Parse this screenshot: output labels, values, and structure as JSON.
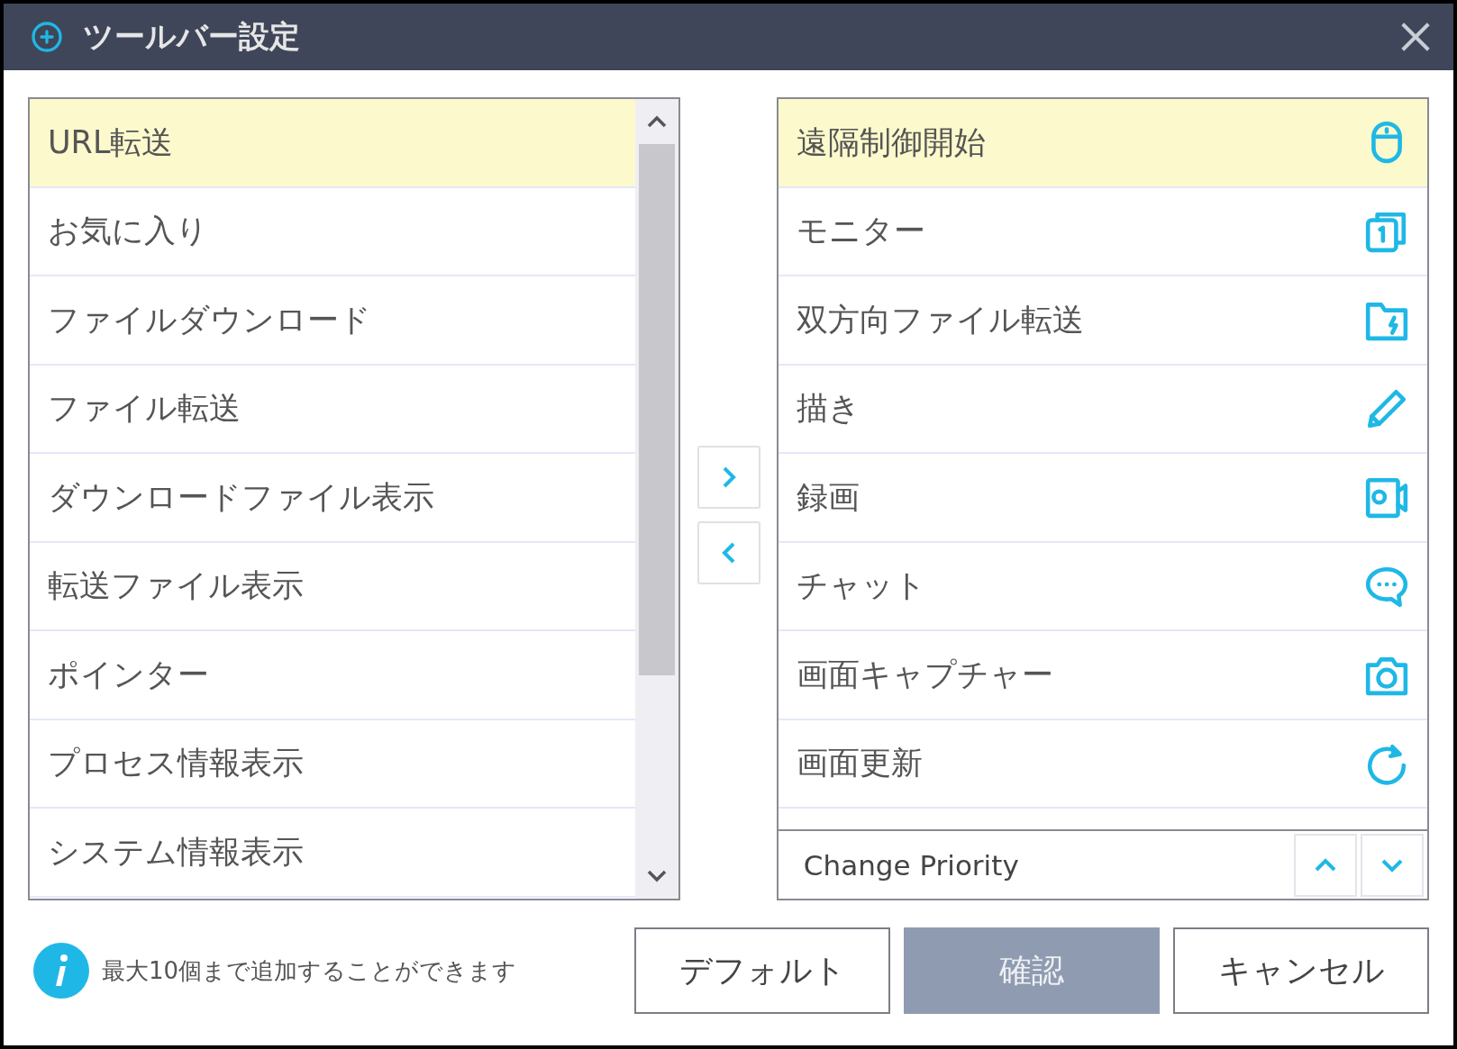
{
  "window": {
    "title": "ツールバー設定"
  },
  "available_items": [
    {
      "label": "URL転送",
      "selected": true
    },
    {
      "label": "お気に入り",
      "selected": false
    },
    {
      "label": "ファイルダウンロード",
      "selected": false
    },
    {
      "label": "ファイル転送",
      "selected": false
    },
    {
      "label": "ダウンロードファイル表示",
      "selected": false
    },
    {
      "label": "転送ファイル表示",
      "selected": false
    },
    {
      "label": "ポインター",
      "selected": false
    },
    {
      "label": "プロセス情報表示",
      "selected": false
    },
    {
      "label": "システム情報表示",
      "selected": false
    }
  ],
  "toolbar_items": [
    {
      "label": "遠隔制御開始",
      "selected": true
    },
    {
      "label": "モニター",
      "selected": false
    },
    {
      "label": "双方向ファイル転送",
      "selected": false
    },
    {
      "label": "描き",
      "selected": false
    },
    {
      "label": "録画",
      "selected": false
    },
    {
      "label": "チャット",
      "selected": false
    },
    {
      "label": "画面キャプチャー",
      "selected": false
    },
    {
      "label": "画面更新",
      "selected": false
    }
  ],
  "priority": {
    "label": "Change Priority"
  },
  "info": {
    "text": "最大10個まで追加することができます"
  },
  "buttons": [
    {
      "label": "デフォルト",
      "kind": "normal"
    },
    {
      "label": "確認",
      "kind": "primary"
    },
    {
      "label": "キャンセル",
      "kind": "normal"
    }
  ]
}
